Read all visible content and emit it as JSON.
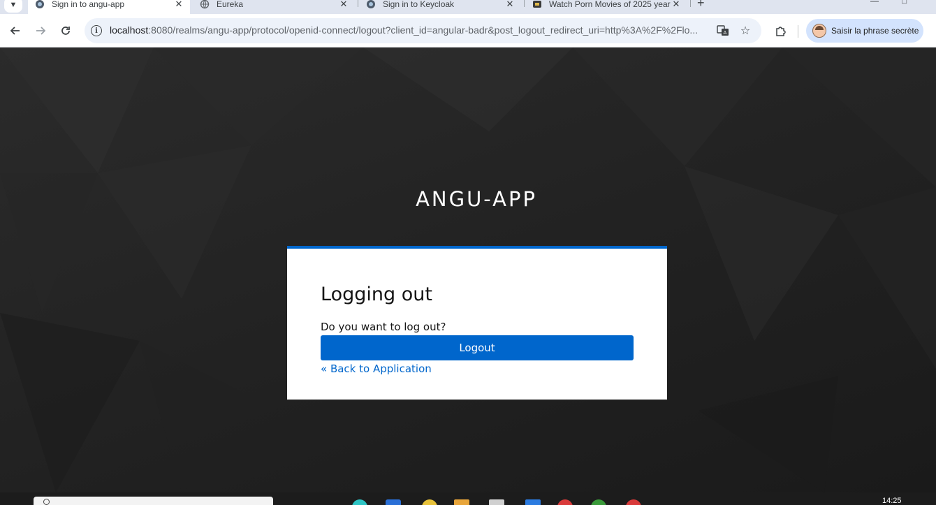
{
  "browser": {
    "tabs": [
      {
        "title": "Sign in to angu-app",
        "active": true
      },
      {
        "title": "Eureka",
        "active": false
      },
      {
        "title": "Sign in to Keycloak",
        "active": false
      },
      {
        "title": "Watch Porn Movies of 2025 year",
        "active": false
      }
    ],
    "url": {
      "host": "localhost",
      "rest": ":8080/realms/angu-app/protocol/openid-connect/logout?client_id=angular-badr&post_logout_redirect_uri=http%3A%2F%2Flo..."
    },
    "profile_label": "Saisir la phrase secrète"
  },
  "page": {
    "realm_name": "ANGU-APP",
    "card_title": "Logging out",
    "question": "Do you want to log out?",
    "logout_button": "Logout",
    "back_link": "« Back to Application",
    "accent_color": "#0066cc"
  },
  "taskbar": {
    "clock": "14:25"
  }
}
